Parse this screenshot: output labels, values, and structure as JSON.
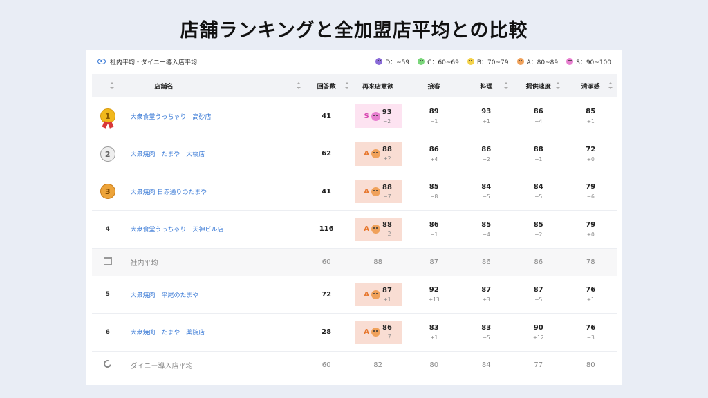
{
  "page_title": "店舗ランキングと全加盟店平均との比較",
  "legend": {
    "label": "社内平均・ダイニー導入店平均",
    "grades": [
      {
        "grade": "D",
        "text": "D：~59",
        "color": "#8a6bd8"
      },
      {
        "grade": "C",
        "text": "C：60~69",
        "color": "#7bd67b"
      },
      {
        "grade": "B",
        "text": "B：70~79",
        "color": "#f4d24a"
      },
      {
        "grade": "A",
        "text": "A：80~89",
        "color": "#f0a15a"
      },
      {
        "grade": "S",
        "text": "S：90~100",
        "color": "#e87fd0"
      }
    ]
  },
  "columns": [
    "店舗名",
    "回答数",
    "再来店意欲",
    "接客",
    "料理",
    "提供速度",
    "清潔感"
  ],
  "rows": [
    {
      "type": "store",
      "rank": "1",
      "medal": "gold",
      "name": "大衆食堂うっちゃり　高砂店",
      "answers": "41",
      "intent": {
        "grade": "S",
        "value": "93",
        "delta": "−2"
      },
      "metrics": [
        {
          "v": "89",
          "d": "−1"
        },
        {
          "v": "93",
          "d": "+1"
        },
        {
          "v": "86",
          "d": "−4"
        },
        {
          "v": "85",
          "d": "+1"
        }
      ]
    },
    {
      "type": "store",
      "rank": "2",
      "medal": "silver",
      "name": "大衆焼肉　たまや　大橋店",
      "answers": "62",
      "intent": {
        "grade": "A",
        "value": "88",
        "delta": "+2"
      },
      "metrics": [
        {
          "v": "86",
          "d": "+4"
        },
        {
          "v": "86",
          "d": "−2"
        },
        {
          "v": "88",
          "d": "+1"
        },
        {
          "v": "72",
          "d": "+0"
        }
      ]
    },
    {
      "type": "store",
      "rank": "3",
      "medal": "bronze",
      "name": "大衆焼肉 日赤通りのたまや",
      "answers": "41",
      "intent": {
        "grade": "A",
        "value": "88",
        "delta": "−7"
      },
      "metrics": [
        {
          "v": "85",
          "d": "−8"
        },
        {
          "v": "84",
          "d": "−5"
        },
        {
          "v": "84",
          "d": "−5"
        },
        {
          "v": "79",
          "d": "−6"
        }
      ]
    },
    {
      "type": "store",
      "rank": "4",
      "medal": "",
      "name": "大衆食堂うっちゃり　天神ビル店",
      "answers": "116",
      "intent": {
        "grade": "A",
        "value": "88",
        "delta": "−2"
      },
      "metrics": [
        {
          "v": "86",
          "d": "−1"
        },
        {
          "v": "85",
          "d": "−4"
        },
        {
          "v": "85",
          "d": "+2"
        },
        {
          "v": "79",
          "d": "+0"
        }
      ]
    },
    {
      "type": "avg",
      "icon": "shop-icon",
      "name": "社内平均",
      "answers": "60",
      "intent_value": "88",
      "metrics": [
        "87",
        "86",
        "86",
        "78"
      ]
    },
    {
      "type": "store",
      "rank": "5",
      "medal": "",
      "name": "大衆焼肉　平尾のたまや",
      "answers": "72",
      "intent": {
        "grade": "A",
        "value": "87",
        "delta": "+1"
      },
      "metrics": [
        {
          "v": "92",
          "d": "+13"
        },
        {
          "v": "87",
          "d": "+3"
        },
        {
          "v": "87",
          "d": "+5"
        },
        {
          "v": "76",
          "d": "+1"
        }
      ]
    },
    {
      "type": "store",
      "rank": "6",
      "medal": "",
      "name": "大衆焼肉　たまや　薬院店",
      "answers": "28",
      "intent": {
        "grade": "A",
        "value": "86",
        "delta": "−7"
      },
      "metrics": [
        {
          "v": "83",
          "d": "+1"
        },
        {
          "v": "83",
          "d": "−5"
        },
        {
          "v": "90",
          "d": "+12"
        },
        {
          "v": "76",
          "d": "−3"
        }
      ]
    },
    {
      "type": "avg",
      "icon": "ring-icon",
      "name": "ダイニー導入店平均",
      "answers": "60",
      "intent_value": "82",
      "metrics": [
        "80",
        "84",
        "77",
        "80"
      ]
    }
  ],
  "colors": {
    "S_bg": "#fde3f1",
    "S_text": "#d845b0",
    "S_face": "#e87fd0",
    "A_bg": "#f9ddd3",
    "A_text": "#e7782f",
    "A_face": "#f0a15a",
    "link": "#3a7ad6"
  }
}
